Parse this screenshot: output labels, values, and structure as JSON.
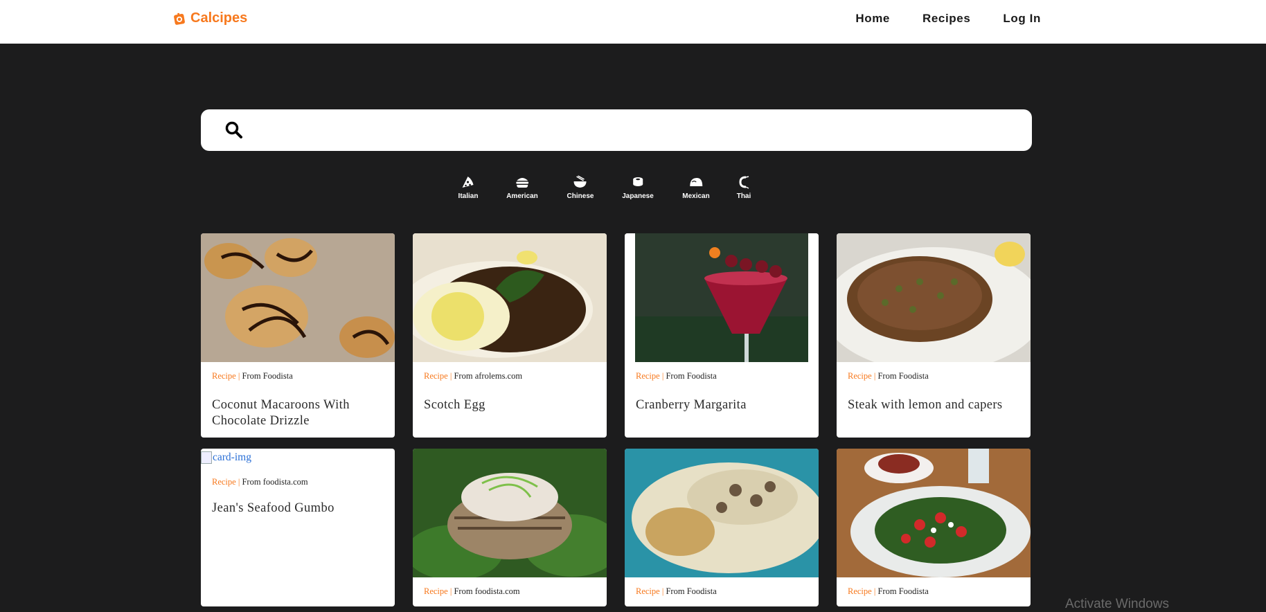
{
  "brand": {
    "name": "Calcipes",
    "color": "#f7791e"
  },
  "nav": {
    "items": [
      "Home",
      "Recipes",
      "Log In"
    ]
  },
  "search": {
    "placeholder": "",
    "value": "",
    "icon": "search-icon"
  },
  "cuisines": [
    {
      "label": "Italian",
      "icon": "pizza-icon"
    },
    {
      "label": "American",
      "icon": "burger-icon"
    },
    {
      "label": "Chinese",
      "icon": "noodle-bowl-icon"
    },
    {
      "label": "Japanese",
      "icon": "sushi-icon"
    },
    {
      "label": "Mexican",
      "icon": "taco-icon"
    },
    {
      "label": "Thai",
      "icon": "shrimp-icon"
    }
  ],
  "cards": [
    {
      "tag": "Recipe",
      "source": "From Foodista",
      "title": "Coconut Macaroons With Chocolate Drizzle",
      "image": "coconut-macaroons-photo"
    },
    {
      "tag": "Recipe",
      "source": "From afrolems.com",
      "title": "Scotch Egg",
      "image": "scotch-egg-photo"
    },
    {
      "tag": "Recipe",
      "source": "From Foodista",
      "title": "Cranberry Margarita",
      "image": "cranberry-margarita-photo"
    },
    {
      "tag": "Recipe",
      "source": "From Foodista",
      "title": "Steak with lemon and capers",
      "image": "steak-capers-photo"
    },
    {
      "tag": "Recipe",
      "source": "From foodista.com",
      "title": "Jean's Seafood Gumbo",
      "image": "broken-image",
      "alt": "card-img"
    },
    {
      "tag": "Recipe",
      "source": "From foodista.com",
      "title": "",
      "image": "burger-spinach-photo"
    },
    {
      "tag": "Recipe",
      "source": "From Foodista",
      "title": "",
      "image": "mushroom-chicken-photo"
    },
    {
      "tag": "Recipe",
      "source": "From Foodista",
      "title": "",
      "image": "strawberry-salad-photo"
    }
  ],
  "watermark": "Activate Windows"
}
